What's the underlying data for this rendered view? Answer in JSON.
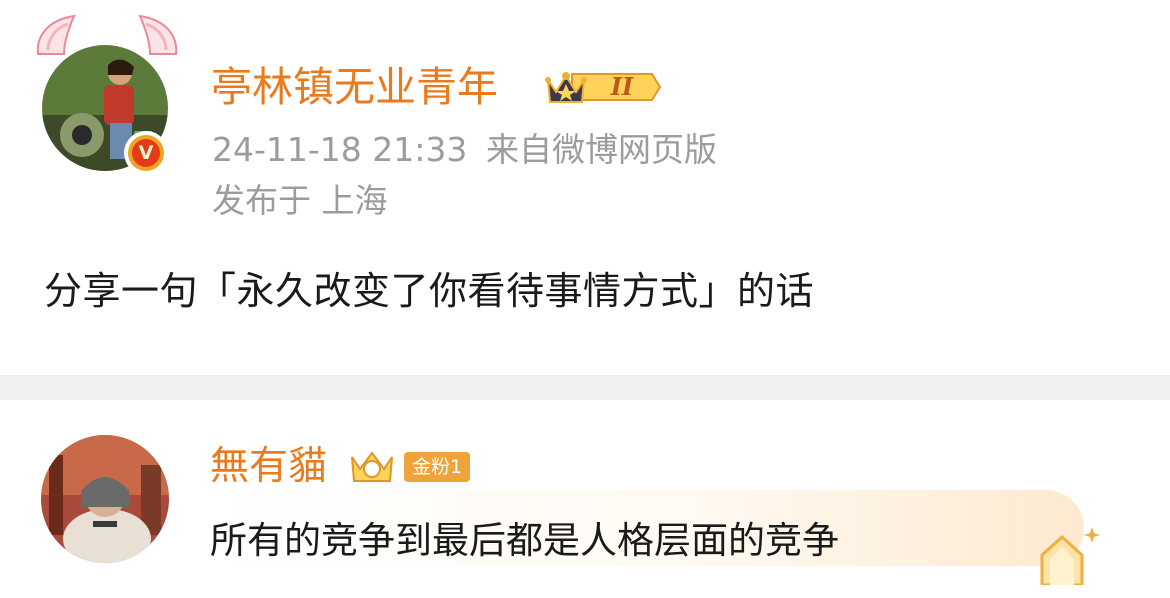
{
  "post": {
    "author": "亭林镇无业青年",
    "level_badge": "II",
    "timestamp": "24-11-18 21:33",
    "source": "来自微博网页版",
    "location": "发布于 上海",
    "content": "分享一句「永久改变了你看待事情方式」的话",
    "verified_label": "V"
  },
  "comment": {
    "author": "無有貓",
    "fan_badge": "金粉1",
    "content": "所有的竞争到最后都是人格层面的竞争"
  }
}
